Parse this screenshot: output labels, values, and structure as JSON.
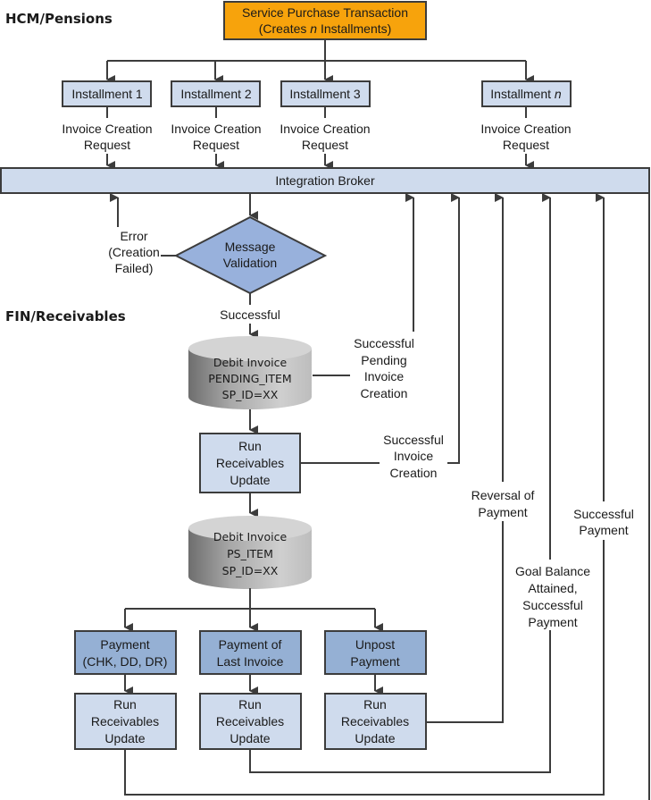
{
  "sections": {
    "hcm": "HCM/Pensions",
    "fin": "FIN/Receivables"
  },
  "colors": {
    "start": "#f7a30c",
    "light_box": "#cfdbed",
    "dark_box": "#95b0d4",
    "diamond": "#98b1dc",
    "broker": "#cfdbed",
    "line": "#3c3c3c"
  },
  "start": {
    "line1": "Service Purchase Transaction",
    "line2_pre": "(Creates ",
    "line2_em": "n",
    "line2_post": " Installments)"
  },
  "installments": [
    {
      "label": "Installment 1",
      "em": ""
    },
    {
      "label": "Installment 2",
      "em": ""
    },
    {
      "label": "Installment 3",
      "em": ""
    },
    {
      "label": "Installment ",
      "em": "n"
    }
  ],
  "request_label": {
    "line1": "Invoice Creation",
    "line2": "Request"
  },
  "broker": "Integration Broker",
  "validation": {
    "line1": "Message",
    "line2": "Validation"
  },
  "error_label": {
    "line1": "Error",
    "line2": "(Creation",
    "line3": "Failed)"
  },
  "successful": "Successful",
  "db_pending": {
    "line1": "Debit Invoice",
    "line2": "PENDING_ITEM",
    "line3": "SP_ID=XX"
  },
  "pending_label": {
    "line1": "Successful",
    "line2": "Pending",
    "line3": "Invoice",
    "line4": "Creation"
  },
  "run_update": {
    "line1": "Run",
    "line2": "Receivables",
    "line3": "Update"
  },
  "creation_label": {
    "line1": "Successful",
    "line2": "Invoice",
    "line3": "Creation"
  },
  "db_item": {
    "line1": "Debit Invoice",
    "line2": "PS_ITEM",
    "line3": "SP_ID=XX"
  },
  "payments": [
    {
      "line1": "Payment",
      "line2": "(CHK, DD, DR)"
    },
    {
      "line1": "Payment of",
      "line2": "Last Invoice"
    },
    {
      "line1": "Unpost",
      "line2": "Payment"
    }
  ],
  "reversal_label": {
    "line1": "Reversal of",
    "line2": "Payment"
  },
  "goal_label": {
    "line1": "Goal Balance",
    "line2": "Attained,",
    "line3": "Successful",
    "line4": "Payment"
  },
  "success_payment_label": {
    "line1": "Successful",
    "line2": "Payment"
  }
}
